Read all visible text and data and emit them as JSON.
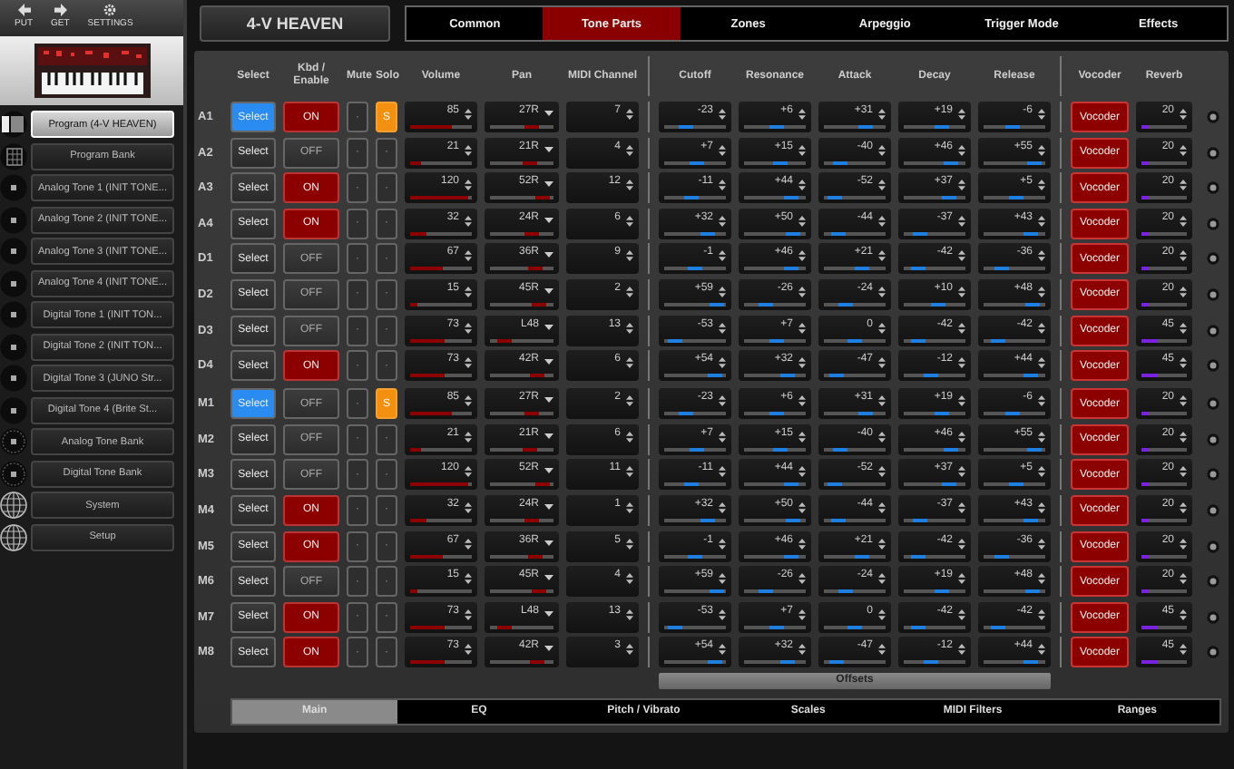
{
  "toolbar": [
    {
      "label": "PUT",
      "kind": "up"
    },
    {
      "label": "GET",
      "kind": "down"
    },
    {
      "label": "SETTINGS",
      "kind": "gear"
    }
  ],
  "sidebar": {
    "items": [
      {
        "label": "Program (4-V HEAVEN)",
        "kind": "program",
        "selected": true
      },
      {
        "label": "Program Bank",
        "kind": "bank",
        "selected": false
      },
      {
        "label": "Analog Tone 1 (INIT TONE...",
        "kind": "tone",
        "selected": false
      },
      {
        "label": "Analog Tone 2 (INIT TONE...",
        "kind": "tone",
        "selected": false
      },
      {
        "label": "Analog Tone 3 (INIT TONE...",
        "kind": "tone",
        "selected": false
      },
      {
        "label": "Analog Tone 4 (INIT TONE...",
        "kind": "tone",
        "selected": false
      },
      {
        "label": "Digital Tone 1 (INIT TON...",
        "kind": "tone",
        "selected": false
      },
      {
        "label": "Digital Tone 2 (INIT TON...",
        "kind": "tone",
        "selected": false
      },
      {
        "label": "Digital Tone 3 (JUNO Str...",
        "kind": "tone",
        "selected": false
      },
      {
        "label": "Digital Tone 4 (Brite St...",
        "kind": "tone",
        "selected": false
      },
      {
        "label": "Analog Tone Bank",
        "kind": "tonebank",
        "selected": false
      },
      {
        "label": "Digital Tone Bank",
        "kind": "tonebank",
        "selected": false
      },
      {
        "label": "System",
        "kind": "globe",
        "selected": false
      },
      {
        "label": "Setup",
        "kind": "globe",
        "selected": false
      }
    ]
  },
  "title": "4-V HEAVEN",
  "tabs": [
    {
      "label": "Common",
      "selected": false
    },
    {
      "label": "Tone Parts",
      "selected": true
    },
    {
      "label": "Zones",
      "selected": false
    },
    {
      "label": "Arpeggio",
      "selected": false
    },
    {
      "label": "Trigger Mode",
      "selected": false
    },
    {
      "label": "Effects",
      "selected": false
    }
  ],
  "columns": [
    "Select",
    "Kbd / Enable",
    "Mute",
    "Solo",
    "Volume",
    "Pan",
    "MIDI Channel",
    "Cutoff",
    "Resonance",
    "Attack",
    "Decay",
    "Release",
    "Vocoder",
    "Reverb"
  ],
  "groups": [
    {
      "rows": [
        {
          "label": "A1",
          "select": {
            "label": "Select",
            "selected": true
          },
          "enable": {
            "label": "ON",
            "on": true
          },
          "mute": {
            "label": "·",
            "on": false
          },
          "solo": {
            "label": "S",
            "on": true
          },
          "volume": {
            "value": "85",
            "level": 0.67
          },
          "pan": {
            "value": "27R",
            "level": 0.71
          },
          "midi_channel": "7",
          "offsets": [
            {
              "value": "-23",
              "level": 0.32
            },
            {
              "value": "+6",
              "level": 0.55
            },
            {
              "value": "+31",
              "level": 0.74
            },
            {
              "value": "+19",
              "level": 0.65
            },
            {
              "value": "-6",
              "level": 0.45
            }
          ],
          "vocoder": {
            "label": "Vocoder",
            "on": true
          },
          "reverb": {
            "value": "20",
            "level": 0.16
          }
        },
        {
          "label": "A2",
          "select": {
            "label": "Select",
            "selected": false
          },
          "enable": {
            "label": "OFF",
            "on": false
          },
          "mute": {
            "label": "·",
            "on": false
          },
          "solo": {
            "label": "·",
            "on": false
          },
          "volume": {
            "value": "21",
            "level": 0.17
          },
          "pan": {
            "value": "21R",
            "level": 0.66
          },
          "midi_channel": "4",
          "offsets": [
            {
              "value": "+7",
              "level": 0.55
            },
            {
              "value": "+15",
              "level": 0.62
            },
            {
              "value": "-40",
              "level": 0.19
            },
            {
              "value": "+46",
              "level": 0.86
            },
            {
              "value": "+55",
              "level": 0.93
            }
          ],
          "vocoder": {
            "label": "Vocoder",
            "on": true
          },
          "reverb": {
            "value": "20",
            "level": 0.16
          }
        },
        {
          "label": "A3",
          "select": {
            "label": "Select",
            "selected": false
          },
          "enable": {
            "label": "ON",
            "on": true
          },
          "mute": {
            "label": "·",
            "on": false
          },
          "solo": {
            "label": "·",
            "on": false
          },
          "volume": {
            "value": "120",
            "level": 0.94
          },
          "pan": {
            "value": "52R",
            "level": 0.91
          },
          "midi_channel": "12",
          "offsets": [
            {
              "value": "-11",
              "level": 0.41
            },
            {
              "value": "+44",
              "level": 0.84
            },
            {
              "value": "-52",
              "level": 0.09
            },
            {
              "value": "+37",
              "level": 0.79
            },
            {
              "value": "+5",
              "level": 0.54
            }
          ],
          "vocoder": {
            "label": "Vocoder",
            "on": true
          },
          "reverb": {
            "value": "20",
            "level": 0.16
          }
        },
        {
          "label": "A4",
          "select": {
            "label": "Select",
            "selected": false
          },
          "enable": {
            "label": "ON",
            "on": true
          },
          "mute": {
            "label": "·",
            "on": false
          },
          "solo": {
            "label": "·",
            "on": false
          },
          "volume": {
            "value": "32",
            "level": 0.25
          },
          "pan": {
            "value": "24R",
            "level": 0.69
          },
          "midi_channel": "6",
          "offsets": [
            {
              "value": "+32",
              "level": 0.75
            },
            {
              "value": "+50",
              "level": 0.89
            },
            {
              "value": "-44",
              "level": 0.16
            },
            {
              "value": "-37",
              "level": 0.21
            },
            {
              "value": "+43",
              "level": 0.84
            }
          ],
          "vocoder": {
            "label": "Vocoder",
            "on": true
          },
          "reverb": {
            "value": "20",
            "level": 0.16
          }
        },
        {
          "label": "D1",
          "select": {
            "label": "Select",
            "selected": false
          },
          "enable": {
            "label": "OFF",
            "on": false
          },
          "mute": {
            "label": "·",
            "on": false
          },
          "solo": {
            "label": "·",
            "on": false
          },
          "volume": {
            "value": "67",
            "level": 0.53
          },
          "pan": {
            "value": "36R",
            "level": 0.78
          },
          "midi_channel": "9",
          "offsets": [
            {
              "value": "-1",
              "level": 0.49
            },
            {
              "value": "+46",
              "level": 0.86
            },
            {
              "value": "+21",
              "level": 0.66
            },
            {
              "value": "-42",
              "level": 0.17
            },
            {
              "value": "-36",
              "level": 0.22
            }
          ],
          "vocoder": {
            "label": "Vocoder",
            "on": true
          },
          "reverb": {
            "value": "20",
            "level": 0.16
          }
        },
        {
          "label": "D2",
          "select": {
            "label": "Select",
            "selected": false
          },
          "enable": {
            "label": "OFF",
            "on": false
          },
          "mute": {
            "label": "·",
            "on": false
          },
          "solo": {
            "label": "·",
            "on": false
          },
          "volume": {
            "value": "15",
            "level": 0.12
          },
          "pan": {
            "value": "45R",
            "level": 0.85
          },
          "midi_channel": "2",
          "offsets": [
            {
              "value": "+59",
              "level": 0.96
            },
            {
              "value": "-26",
              "level": 0.3
            },
            {
              "value": "-24",
              "level": 0.31
            },
            {
              "value": "+10",
              "level": 0.58
            },
            {
              "value": "+48",
              "level": 0.88
            }
          ],
          "vocoder": {
            "label": "Vocoder",
            "on": true
          },
          "reverb": {
            "value": "20",
            "level": 0.16
          }
        },
        {
          "label": "D3",
          "select": {
            "label": "Select",
            "selected": false
          },
          "enable": {
            "label": "OFF",
            "on": false
          },
          "mute": {
            "label": "·",
            "on": false
          },
          "solo": {
            "label": "·",
            "on": false
          },
          "volume": {
            "value": "73",
            "level": 0.57
          },
          "pan": {
            "value": "L48",
            "level": 0.13
          },
          "midi_channel": "13",
          "offsets": [
            {
              "value": "-53",
              "level": 0.09
            },
            {
              "value": "+7",
              "level": 0.55
            },
            {
              "value": "0",
              "level": 0.5
            },
            {
              "value": "-42",
              "level": 0.17
            },
            {
              "value": "-42",
              "level": 0.17
            }
          ],
          "vocoder": {
            "label": "Vocoder",
            "on": true
          },
          "reverb": {
            "value": "45",
            "level": 0.35
          }
        },
        {
          "label": "D4",
          "select": {
            "label": "Select",
            "selected": false
          },
          "enable": {
            "label": "ON",
            "on": true
          },
          "mute": {
            "label": "·",
            "on": false
          },
          "solo": {
            "label": "·",
            "on": false
          },
          "volume": {
            "value": "73",
            "level": 0.57
          },
          "pan": {
            "value": "42R",
            "level": 0.83
          },
          "midi_channel": "6",
          "offsets": [
            {
              "value": "+54",
              "level": 0.92
            },
            {
              "value": "+32",
              "level": 0.75
            },
            {
              "value": "-47",
              "level": 0.13
            },
            {
              "value": "-12",
              "level": 0.41
            },
            {
              "value": "+44",
              "level": 0.84
            }
          ],
          "vocoder": {
            "label": "Vocoder",
            "on": true
          },
          "reverb": {
            "value": "45",
            "level": 0.35
          }
        }
      ]
    },
    {
      "rows": [
        {
          "label": "M1",
          "select": {
            "label": "Select",
            "selected": true
          },
          "enable": {
            "label": "OFF",
            "on": false
          },
          "mute": {
            "label": "·",
            "on": false
          },
          "solo": {
            "label": "S",
            "on": true
          },
          "volume": {
            "value": "85",
            "level": 0.67
          },
          "pan": {
            "value": "27R",
            "level": 0.71
          },
          "midi_channel": "2",
          "offsets": [
            {
              "value": "-23",
              "level": 0.32
            },
            {
              "value": "+6",
              "level": 0.55
            },
            {
              "value": "+31",
              "level": 0.74
            },
            {
              "value": "+19",
              "level": 0.65
            },
            {
              "value": "-6",
              "level": 0.45
            }
          ],
          "vocoder": {
            "label": "Vocoder",
            "on": true
          },
          "reverb": {
            "value": "20",
            "level": 0.16
          }
        },
        {
          "label": "M2",
          "select": {
            "label": "Select",
            "selected": false
          },
          "enable": {
            "label": "OFF",
            "on": false
          },
          "mute": {
            "label": "·",
            "on": false
          },
          "solo": {
            "label": "·",
            "on": false
          },
          "volume": {
            "value": "21",
            "level": 0.17
          },
          "pan": {
            "value": "21R",
            "level": 0.66
          },
          "midi_channel": "6",
          "offsets": [
            {
              "value": "+7",
              "level": 0.55
            },
            {
              "value": "+15",
              "level": 0.62
            },
            {
              "value": "-40",
              "level": 0.19
            },
            {
              "value": "+46",
              "level": 0.86
            },
            {
              "value": "+55",
              "level": 0.93
            }
          ],
          "vocoder": {
            "label": "Vocoder",
            "on": true
          },
          "reverb": {
            "value": "20",
            "level": 0.16
          }
        },
        {
          "label": "M3",
          "select": {
            "label": "Select",
            "selected": false
          },
          "enable": {
            "label": "OFF",
            "on": false
          },
          "mute": {
            "label": "·",
            "on": false
          },
          "solo": {
            "label": "·",
            "on": false
          },
          "volume": {
            "value": "120",
            "level": 0.94
          },
          "pan": {
            "value": "52R",
            "level": 0.91
          },
          "midi_channel": "11",
          "offsets": [
            {
              "value": "-11",
              "level": 0.41
            },
            {
              "value": "+44",
              "level": 0.84
            },
            {
              "value": "-52",
              "level": 0.09
            },
            {
              "value": "+37",
              "level": 0.79
            },
            {
              "value": "+5",
              "level": 0.54
            }
          ],
          "vocoder": {
            "label": "Vocoder",
            "on": true
          },
          "reverb": {
            "value": "20",
            "level": 0.16
          }
        },
        {
          "label": "M4",
          "select": {
            "label": "Select",
            "selected": false
          },
          "enable": {
            "label": "ON",
            "on": true
          },
          "mute": {
            "label": "·",
            "on": false
          },
          "solo": {
            "label": "·",
            "on": false
          },
          "volume": {
            "value": "32",
            "level": 0.25
          },
          "pan": {
            "value": "24R",
            "level": 0.69
          },
          "midi_channel": "1",
          "offsets": [
            {
              "value": "+32",
              "level": 0.75
            },
            {
              "value": "+50",
              "level": 0.89
            },
            {
              "value": "-44",
              "level": 0.16
            },
            {
              "value": "-37",
              "level": 0.21
            },
            {
              "value": "+43",
              "level": 0.84
            }
          ],
          "vocoder": {
            "label": "Vocoder",
            "on": true
          },
          "reverb": {
            "value": "20",
            "level": 0.16
          }
        },
        {
          "label": "M5",
          "select": {
            "label": "Select",
            "selected": false
          },
          "enable": {
            "label": "ON",
            "on": true
          },
          "mute": {
            "label": "·",
            "on": false
          },
          "solo": {
            "label": "·",
            "on": false
          },
          "volume": {
            "value": "67",
            "level": 0.53
          },
          "pan": {
            "value": "36R",
            "level": 0.78
          },
          "midi_channel": "5",
          "offsets": [
            {
              "value": "-1",
              "level": 0.49
            },
            {
              "value": "+46",
              "level": 0.86
            },
            {
              "value": "+21",
              "level": 0.66
            },
            {
              "value": "-42",
              "level": 0.17
            },
            {
              "value": "-36",
              "level": 0.22
            }
          ],
          "vocoder": {
            "label": "Vocoder",
            "on": true
          },
          "reverb": {
            "value": "20",
            "level": 0.16
          }
        },
        {
          "label": "M6",
          "select": {
            "label": "Select",
            "selected": false
          },
          "enable": {
            "label": "OFF",
            "on": false
          },
          "mute": {
            "label": "·",
            "on": false
          },
          "solo": {
            "label": "·",
            "on": false
          },
          "volume": {
            "value": "15",
            "level": 0.12
          },
          "pan": {
            "value": "45R",
            "level": 0.85
          },
          "midi_channel": "4",
          "offsets": [
            {
              "value": "+59",
              "level": 0.96
            },
            {
              "value": "-26",
              "level": 0.3
            },
            {
              "value": "-24",
              "level": 0.31
            },
            {
              "value": "+19",
              "level": 0.65
            },
            {
              "value": "+48",
              "level": 0.88
            }
          ],
          "vocoder": {
            "label": "Vocoder",
            "on": true
          },
          "reverb": {
            "value": "20",
            "level": 0.16
          }
        },
        {
          "label": "M7",
          "select": {
            "label": "Select",
            "selected": false
          },
          "enable": {
            "label": "ON",
            "on": true
          },
          "mute": {
            "label": "·",
            "on": false
          },
          "solo": {
            "label": "·",
            "on": false
          },
          "volume": {
            "value": "73",
            "level": 0.57
          },
          "pan": {
            "value": "L48",
            "level": 0.13
          },
          "midi_channel": "13",
          "offsets": [
            {
              "value": "-53",
              "level": 0.09
            },
            {
              "value": "+7",
              "level": 0.55
            },
            {
              "value": "0",
              "level": 0.5
            },
            {
              "value": "-42",
              "level": 0.17
            },
            {
              "value": "-42",
              "level": 0.17
            }
          ],
          "vocoder": {
            "label": "Vocoder",
            "on": true
          },
          "reverb": {
            "value": "45",
            "level": 0.35
          }
        },
        {
          "label": "M8",
          "select": {
            "label": "Select",
            "selected": false
          },
          "enable": {
            "label": "ON",
            "on": true
          },
          "mute": {
            "label": "·",
            "on": false
          },
          "solo": {
            "label": "·",
            "on": false
          },
          "volume": {
            "value": "73",
            "level": 0.57
          },
          "pan": {
            "value": "42R",
            "level": 0.83
          },
          "midi_channel": "3",
          "offsets": [
            {
              "value": "+54",
              "level": 0.92
            },
            {
              "value": "+32",
              "level": 0.75
            },
            {
              "value": "-47",
              "level": 0.13
            },
            {
              "value": "-12",
              "level": 0.41
            },
            {
              "value": "+44",
              "level": 0.84
            }
          ],
          "vocoder": {
            "label": "Vocoder",
            "on": true
          },
          "reverb": {
            "value": "45",
            "level": 0.35
          }
        }
      ]
    }
  ],
  "offsets_label": "Offsets",
  "bottom_tabs": [
    {
      "label": "Main",
      "selected": true
    },
    {
      "label": "EQ",
      "selected": false
    },
    {
      "label": "Pitch / Vibrato",
      "selected": false
    },
    {
      "label": "Scales",
      "selected": false
    },
    {
      "label": "MIDI Filters",
      "selected": false
    },
    {
      "label": "Ranges",
      "selected": false
    }
  ]
}
